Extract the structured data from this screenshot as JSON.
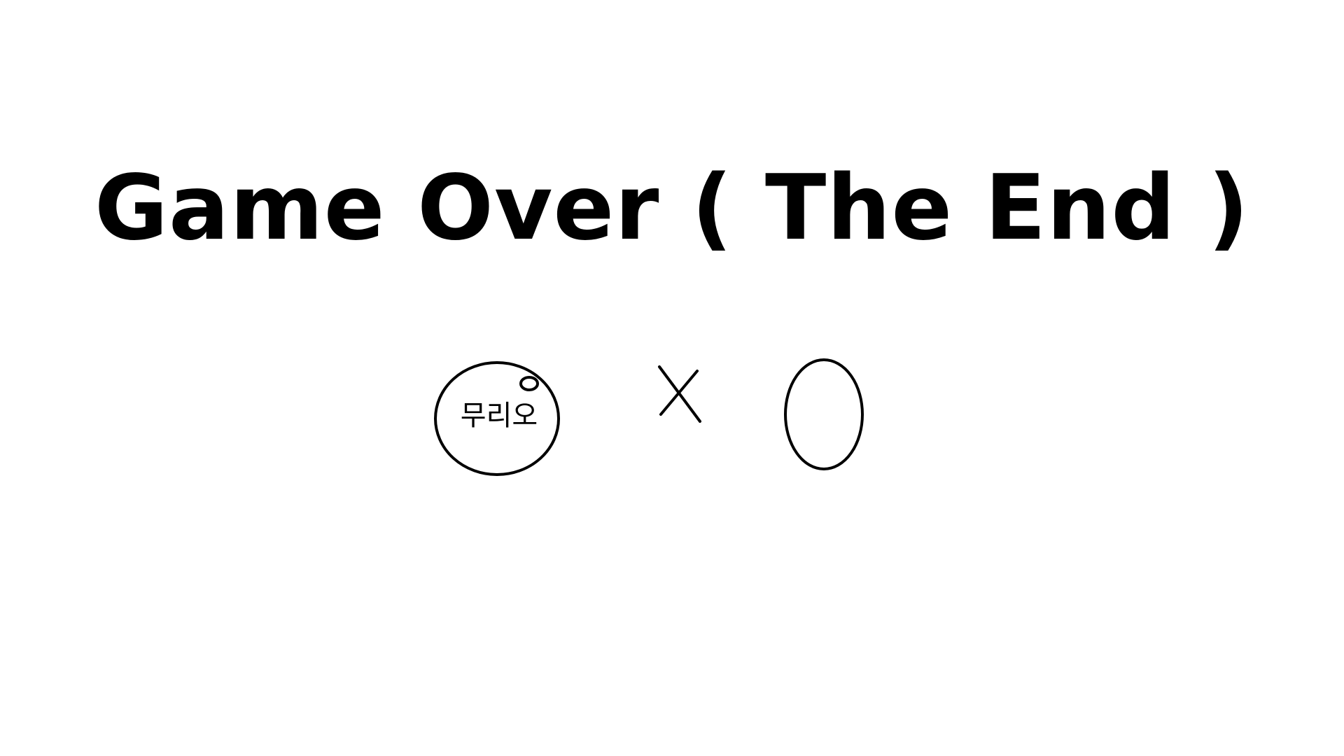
{
  "screen": {
    "title": "Game Over ( The End )",
    "background_color": "#ffffff",
    "ink_color": "#000000"
  },
  "characters": {
    "left": {
      "label": "무리오",
      "shape": "circle-face-with-small-ring"
    },
    "middle": {
      "shape": "cross-x-mark"
    },
    "right": {
      "shape": "oval-outline"
    }
  }
}
